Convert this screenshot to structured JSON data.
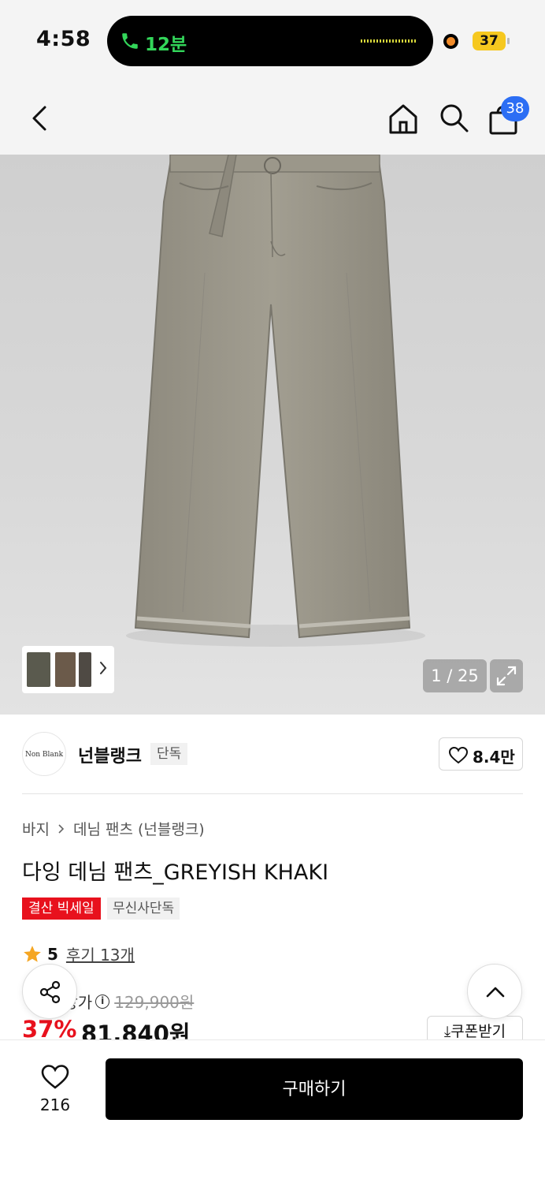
{
  "status_bar": {
    "time": "4:58",
    "call_duration": "12분",
    "battery": "37"
  },
  "header": {
    "cart_count": "38",
    "icons": [
      "back-icon",
      "home-icon",
      "search-icon",
      "shopping-bag-icon"
    ]
  },
  "gallery": {
    "counter": "1 / 25",
    "thumbnail_colors": [
      "#5a5a4e",
      "#6b5a4a",
      "#4f4a44"
    ]
  },
  "brand": {
    "logo_text": "Non Blank",
    "name": "넌블랭크",
    "tag": "단독",
    "likes": "8.4만"
  },
  "product": {
    "breadcrumb": [
      "바지",
      "데님 팬츠 (넌블랭크)"
    ],
    "title": "다잉 데님 팬츠_GREYISH KHAKI",
    "tags": [
      "결산 빅세일",
      "무신사단독"
    ],
    "rating": "5",
    "reviews": "후기 13개",
    "price_label": "정상가",
    "original_price": "129,900원",
    "discount": "37%",
    "sale_price": "81,840원",
    "coupon_label": "쿠폰받기"
  },
  "bottom_bar": {
    "wish_count": "216",
    "buy_label": "구매하기"
  },
  "colors": {
    "accent_red": "#e8111d",
    "badge_blue": "#2c6ef4",
    "call_green": "#33d65a",
    "star": "#f5a623"
  }
}
